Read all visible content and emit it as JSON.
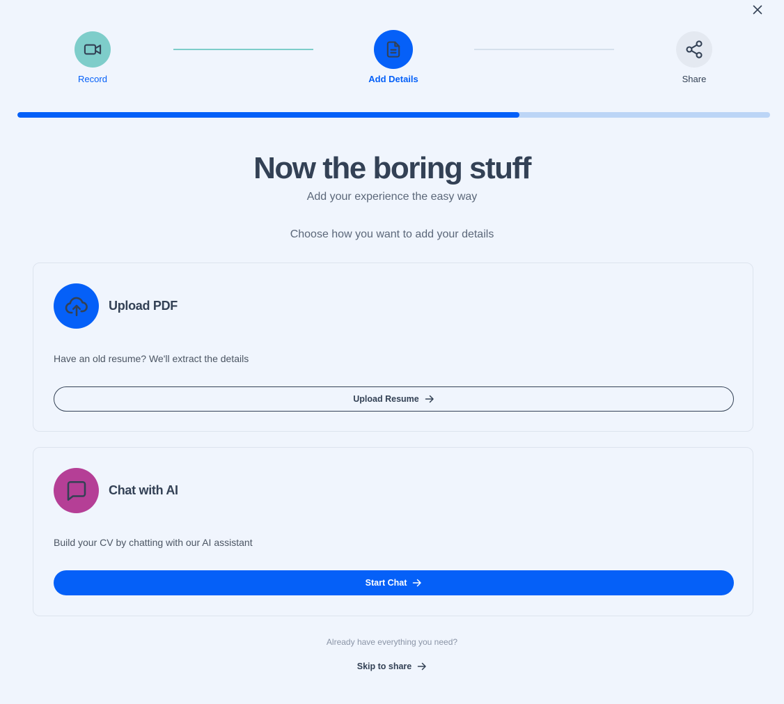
{
  "stepper": {
    "steps": [
      {
        "label": "Record",
        "state": "completed",
        "icon": "video-camera-icon"
      },
      {
        "label": "Add Details",
        "state": "active",
        "icon": "document-icon"
      },
      {
        "label": "Share",
        "state": "upcoming",
        "icon": "share-icon"
      }
    ],
    "progress": 0.667
  },
  "header": {
    "title": "Now the boring stuff",
    "subtitle": "Add your experience the easy way",
    "prompt": "Choose how you want to add your details"
  },
  "options": [
    {
      "title": "Upload PDF",
      "description": "Have an old resume? We'll extract the details",
      "button_label": "Upload Resume",
      "icon": "cloud-upload-icon"
    },
    {
      "title": "Chat with AI",
      "description": "Build your CV by chatting with our AI assistant",
      "button_label": "Start Chat",
      "icon": "chat-bubble-icon"
    }
  ],
  "footer": {
    "note": "Already have everything you need?",
    "skip_label": "Skip to share"
  },
  "colors": {
    "background": "#f0f5fd",
    "primary": "#0560f8",
    "completed": "#7ecdca",
    "teal_line": "#7ecdca",
    "track": "#bcd5f6",
    "pending_line": "#d6e0ec",
    "pending_circle": "#e4e9f1",
    "chat_icon_bg": "#b53f96",
    "text_dark": "#334155"
  }
}
